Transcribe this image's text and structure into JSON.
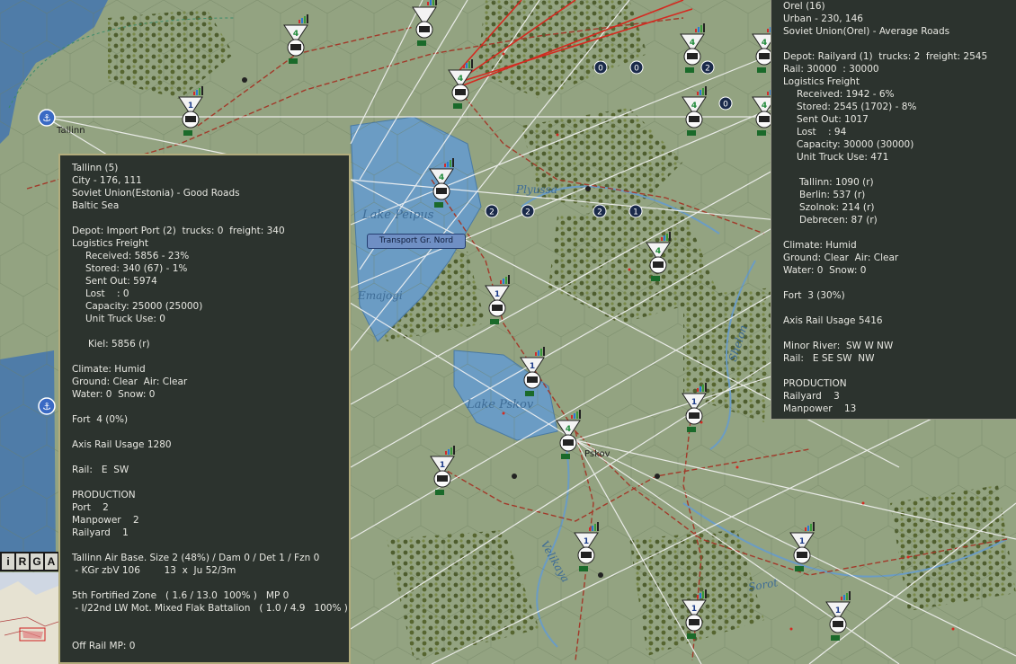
{
  "map": {
    "labels": {
      "lake_peipus": "Lake Peipus",
      "lake_pskov": "Lake Pskov",
      "pskov": "Pskov",
      "velikaya": "Velikaya",
      "sorot": "Sorot",
      "shelon": "Shelon",
      "plyussa": "Plyussa",
      "tallinn": "Tallinn",
      "emajogi": "Emajogi"
    },
    "hq_label": "Transport Gr. Nord",
    "colors": {
      "map_base": "#8fa07e",
      "forest": "#5c6b3a",
      "water": "#6b9cc4",
      "sea": "#4f7ca8",
      "rail_red": "#a23a2a",
      "supply_line": "#f2f2f2",
      "panel_bg": "#2c332e",
      "panel_border": "#b2ac7c"
    },
    "unit_icon": "rail-depot-unit-icon",
    "port_icon": "port-anchor-icon"
  },
  "toolbar": {
    "keys": [
      "i",
      "R",
      "G",
      "A"
    ]
  },
  "left_panel": {
    "lines": [
      "Tallinn (5)",
      "City - 176, 111",
      "Soviet Union(Estonia) - Good Roads",
      "Baltic Sea",
      "",
      "Depot: Import Port (2)  trucks: 0  freight: 340",
      "Logistics Freight",
      "Received: 5856 - 23%",
      "Stored: 340 (67) - 1%",
      "Sent Out: 5974",
      "Lost    : 0",
      "Capacity: 25000 (25000)",
      "Unit Truck Use: 0",
      "",
      "Kiel: 5856 (r)",
      "",
      "Climate: Humid",
      "Ground: Clear  Air: Clear",
      "Water: 0  Snow: 0",
      "",
      "Fort  4 (0%)",
      "",
      "Axis Rail Usage 1280",
      "",
      "Rail:   E  SW",
      "",
      "PRODUCTION",
      "Port    2",
      "Manpower    2",
      "Railyard    1",
      "",
      "Tallinn Air Base. Size 2 (48%) / Dam 0 / Det 1 / Fzn 0",
      " - KGr zbV 106        13  x  Ju 52/3m",
      "",
      "5th Fortified Zone   ( 1.6 / 13.0  100% )   MP 0",
      " - I/22nd LW Mot. Mixed Flak Battalion   ( 1.0 / 4.9   100% )",
      "",
      "",
      "Off Rail MP: 0"
    ]
  },
  "right_panel": {
    "lines": [
      "Orel (16)",
      "Urban - 230, 146",
      "Soviet Union(Orel) - Average Roads",
      "",
      "Depot: Railyard (1)  trucks: 2  freight: 2545",
      "Rail: 30000  : 30000",
      "Logistics Freight",
      "Received: 1942 - 6%",
      "Stored: 2545 (1702) - 8%",
      "Sent Out: 1017",
      "Lost    : 94",
      "Capacity: 30000 (30000)",
      "Unit Truck Use: 471",
      "",
      "Tallinn: 1090 (r)",
      "Berlin: 537 (r)",
      "Szolnok: 214 (r)",
      "Debrecen: 87 (r)",
      "",
      "Climate: Humid",
      "Ground: Clear  Air: Clear",
      "Water: 0  Snow: 0",
      "",
      "Fort  3 (30%)",
      "",
      "Axis Rail Usage 5416",
      "",
      "Minor River:  SW W NW",
      "Rail:   E SE SW  NW",
      "",
      "PRODUCTION",
      "Railyard    3",
      "Manpower    13"
    ]
  }
}
